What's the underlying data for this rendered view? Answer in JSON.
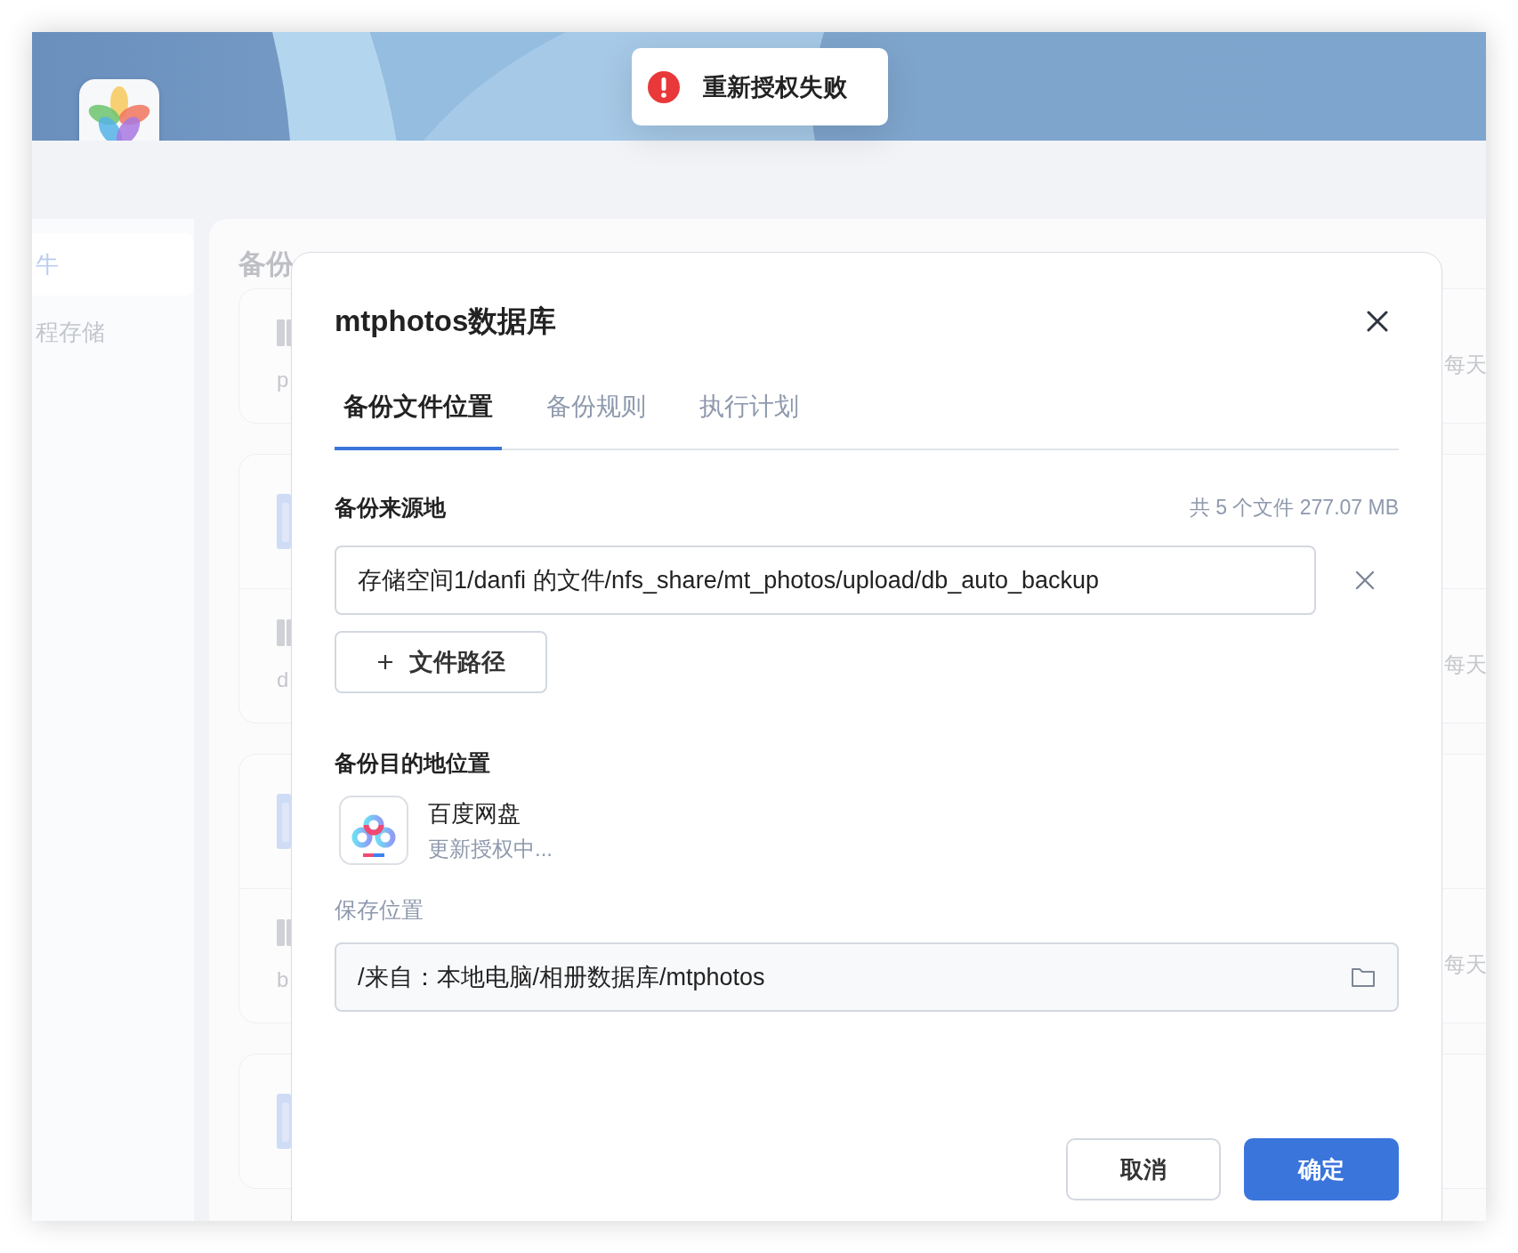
{
  "toast": {
    "kind": "error",
    "message": "重新授权失败"
  },
  "sidebar": {
    "items": [
      {
        "label": "牛",
        "selected": true
      },
      {
        "label": "程存储",
        "selected": false
      }
    ]
  },
  "backdrop": {
    "heading": "备份",
    "cards": [
      {
        "rows": [
          {
            "kind": "server",
            "name": "p",
            "schedule": "每天"
          }
        ]
      },
      {
        "rows": [
          {
            "kind": "folder"
          },
          {
            "kind": "server",
            "name": "d",
            "schedule": "每天"
          }
        ]
      },
      {
        "rows": [
          {
            "kind": "folder"
          },
          {
            "kind": "server",
            "name": "b",
            "schedule": "每天"
          }
        ]
      },
      {
        "rows": [
          {
            "kind": "folder"
          }
        ]
      }
    ]
  },
  "dialog": {
    "title": "mtphotos数据库",
    "tabs": [
      {
        "label": "备份文件位置",
        "selected": true
      },
      {
        "label": "备份规则",
        "selected": false
      },
      {
        "label": "执行计划",
        "selected": false
      }
    ],
    "source": {
      "label": "备份来源地",
      "summary": "共 5 个文件 277.07 MB",
      "paths": [
        "存储空间1/danfi 的文件/nfs_share/mt_photos/upload/db_auto_backup"
      ],
      "add_button": "文件路径"
    },
    "destination": {
      "label": "备份目的地位置",
      "service": {
        "name": "百度网盘",
        "status": "更新授权中..."
      },
      "save_label": "保存位置",
      "save_path": "/来自：本地电脑/相册数据库/mtphotos"
    },
    "buttons": {
      "cancel": "取消",
      "confirm": "确定"
    }
  }
}
